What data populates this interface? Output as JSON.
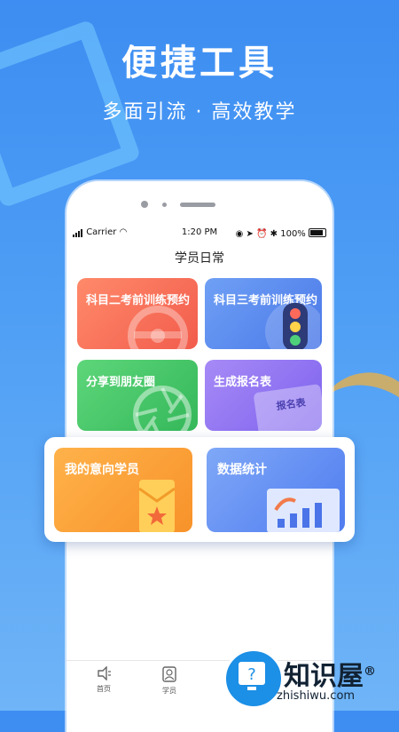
{
  "hero": {
    "title": "便捷工具",
    "subtitle": "多面引流 · 高效教学"
  },
  "statusbar": {
    "carrier": "Carrier",
    "time": "1:20 PM",
    "battery": "100%"
  },
  "screen": {
    "title": "学员日常"
  },
  "cards": [
    {
      "label": "科目二考前训练预约",
      "icon": "steering-wheel-icon"
    },
    {
      "label": "科目三考前训练预约",
      "icon": "traffic-light-icon"
    },
    {
      "label": "分享到朋友圈",
      "icon": "camera-aperture-icon"
    },
    {
      "label": "生成报名表",
      "icon": "form-document-icon",
      "badge": "报名表"
    },
    {
      "label": "我的意向学员",
      "icon": "red-envelope-icon"
    },
    {
      "label": "数据统计",
      "icon": "bar-chart-icon"
    }
  ],
  "tabs": [
    {
      "label": "首页",
      "icon": "home-speaker-icon"
    },
    {
      "label": "学员",
      "icon": "student-icon"
    }
  ],
  "watermark": {
    "text": "知识屋",
    "url": "zhishiwu.com",
    "mark": "®"
  },
  "colors": {
    "background": "#3d8df2",
    "card_orange_red": "#f25c4c",
    "card_blue": "#4a78e8",
    "card_green": "#34b85a",
    "card_purple": "#7d62ee",
    "card_orange": "#f8922a",
    "watermark_blue": "#1c8fe6"
  }
}
